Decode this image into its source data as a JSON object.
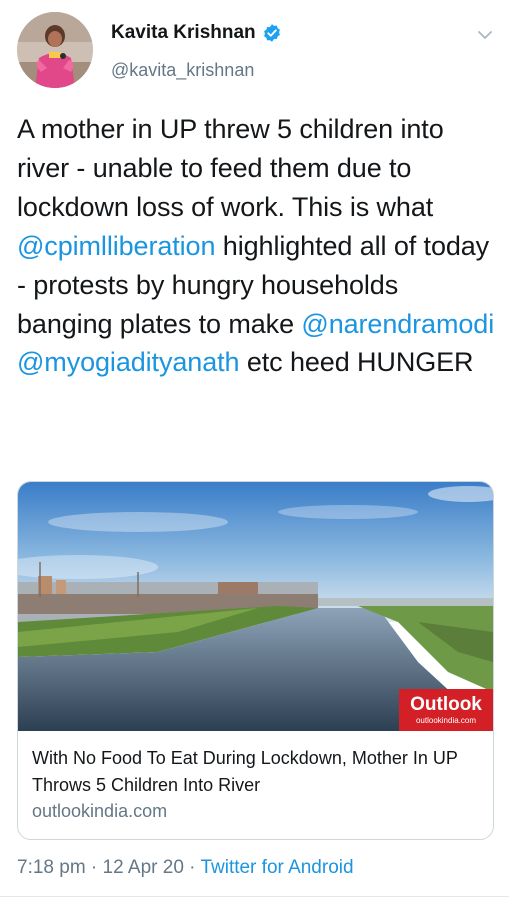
{
  "user": {
    "name": "Kavita Krishnan",
    "handle": "@kavita_krishnan"
  },
  "tweet": {
    "segments": [
      {
        "text": "A mother in UP threw 5 children into river - unable to feed them due to lockdown loss of work. This is what ",
        "type": "text"
      },
      {
        "text": "@cpimlliberation",
        "type": "mention"
      },
      {
        "text": " highlighted all of today - protests by hungry households banging plates to make ",
        "type": "text"
      },
      {
        "text": "@narendramodi",
        "type": "mention"
      },
      {
        "text": " ",
        "type": "text"
      },
      {
        "text": "@myogiadityanath",
        "type": "mention"
      },
      {
        "text": " etc heed HUNGER",
        "type": "text"
      }
    ]
  },
  "card": {
    "image_brand": "Outlook",
    "image_brand_sub": "outlookindia.com",
    "title": "With No Food To Eat During Lockdown, Mother In UP Throws 5 Children Into River",
    "domain": "outlookindia.com"
  },
  "footer": {
    "time": "7:18 pm",
    "sep1": " · ",
    "date": "12 Apr 20",
    "sep2": " · ",
    "source": "Twitter for Android"
  },
  "colors": {
    "link": "#1b95e0",
    "muted": "#657786",
    "verified": "#1da1f2",
    "brand": "#d32027"
  },
  "icons": {
    "verified": "verified-badge-icon",
    "chevron": "chevron-down-icon"
  }
}
